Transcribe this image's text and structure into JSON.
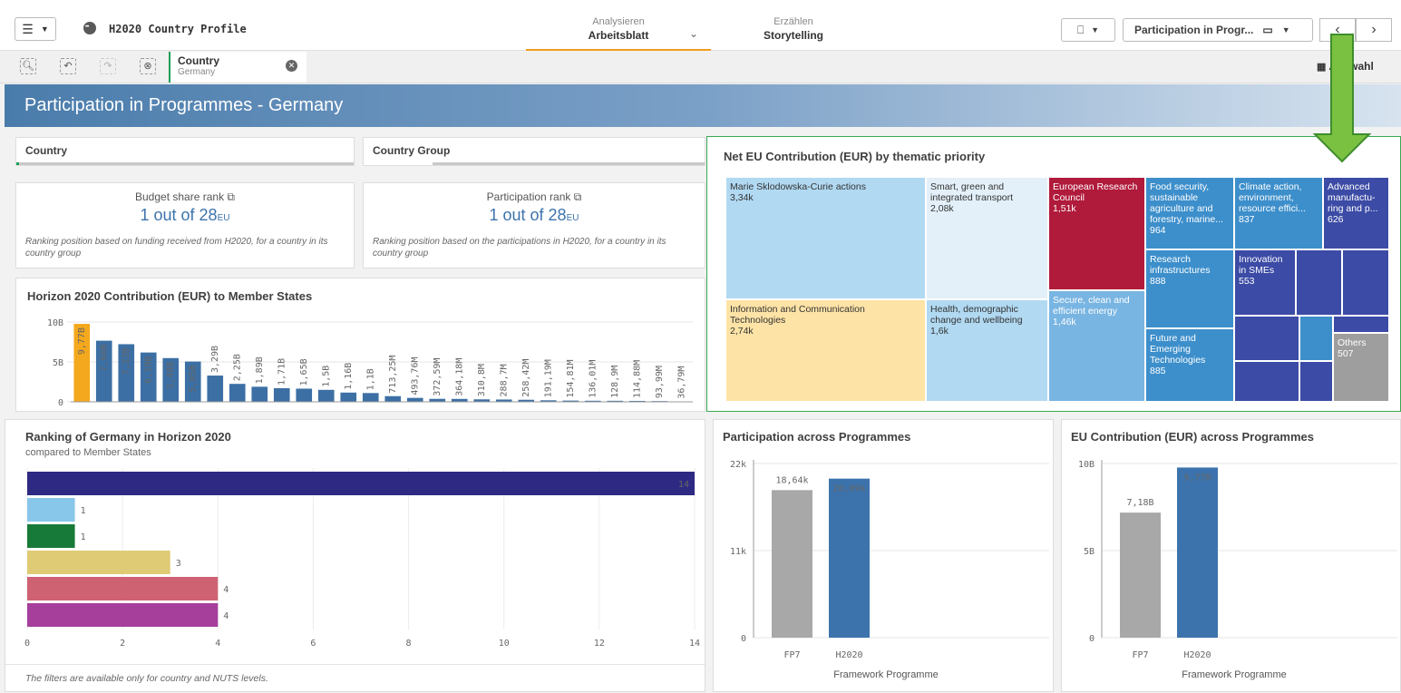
{
  "app": {
    "title": "H2020 Country Profile"
  },
  "nav": {
    "analyze": {
      "small": "Analysieren",
      "big": "Arbeitsblatt"
    },
    "story": {
      "small": "Erzählen",
      "big": "Storytelling"
    }
  },
  "sheet_selector": "Participation in Progr...",
  "selection": {
    "field": "Country",
    "value": "Germany",
    "auswahl": "Auswahl"
  },
  "banner": "Participation in Programmes - Germany",
  "filters": {
    "country": "Country",
    "country_group": "Country Group"
  },
  "kpis": [
    {
      "label": "Budget share rank",
      "value": "1 out of 28",
      "suffix": "EU",
      "note": "Ranking position based on funding received from H2020, for a country in its country group"
    },
    {
      "label": "Participation rank",
      "value": "1 out of 28",
      "suffix": "EU",
      "note": "Ranking position based on the participations in H2020, for a country in its country group"
    }
  ],
  "contribution_chart": {
    "title": "Horizon 2020 Contribution (EUR) to Member States",
    "y_ticks": [
      "10B",
      "5B",
      "0"
    ],
    "labels": [
      "9,77B",
      "7,66B",
      "7,22B",
      "6,18B",
      "5,48B",
      "5,05B",
      "3,29B",
      "2,25B",
      "1,89B",
      "1,71B",
      "1,65B",
      "1,5B",
      "1,16B",
      "1,1B",
      "713,25M",
      "493,76M",
      "372,59M",
      "364,18M",
      "310,8M",
      "288,7M",
      "258,42M",
      "191,19M",
      "154,81M",
      "136,01M",
      "128,9M",
      "114,88M",
      "93,99M",
      "36,79M"
    ]
  },
  "treemap": {
    "title": "Net EU Contribution (EUR) by thematic priority",
    "cells": [
      {
        "name": "Marie Sklodowska-Curie actions",
        "value": "3,34k"
      },
      {
        "name": "Smart, green and integrated transport",
        "value": "2,08k"
      },
      {
        "name": "European Research Council",
        "value": "1,51k"
      },
      {
        "name": "Food security, sustainable agriculture and forestry, marine...",
        "value": "964"
      },
      {
        "name": "Climate action, environment, resource effici...",
        "value": "837"
      },
      {
        "name": "Advanced manufactu-ring and p...",
        "value": "626"
      },
      {
        "name": "Research infrastructures",
        "value": "888"
      },
      {
        "name": "Innovation in SMEs",
        "value": "553"
      },
      {
        "name": "Information and Communication Technologies",
        "value": "2,74k"
      },
      {
        "name": "Health, demographic change and wellbeing",
        "value": "1,6k"
      },
      {
        "name": "Secure, clean and efficient energy",
        "value": "1,46k"
      },
      {
        "name": "Future and Emerging Technologies",
        "value": "885"
      },
      {
        "name": "Others",
        "value": "507"
      }
    ]
  },
  "ranking": {
    "title": "Ranking of Germany in Horizon 2020",
    "subtitle": "compared to Member States",
    "x_ticks": [
      "0",
      "2",
      "4",
      "6",
      "8",
      "10",
      "12",
      "14"
    ],
    "note": "The filters are available only for country and NUTS levels.",
    "colors": [
      "#2e2a83",
      "#88c6ea",
      "#187a38",
      "#dfcb75",
      "#cf6272",
      "#a63e9b"
    ]
  },
  "participation": {
    "title": "Participation across Programmes",
    "y_ticks": [
      "22k",
      "11k",
      "0"
    ],
    "bar_labels": [
      "18,64k",
      "20,09k"
    ],
    "categories": [
      "FP7",
      "H2020"
    ],
    "xlabel": "Framework Programme"
  },
  "eu_contribution": {
    "title": "EU Contribution (EUR) across Programmes",
    "y_ticks": [
      "10B",
      "5B",
      "0"
    ],
    "bar_labels": [
      "7,18B",
      "9,77B"
    ],
    "categories": [
      "FP7",
      "H2020"
    ],
    "xlabel": "Framework Programme"
  },
  "chart_data": [
    {
      "type": "bar",
      "title": "Horizon 2020 Contribution (EUR) to Member States",
      "ylim": [
        0,
        10
      ],
      "ylabel": "",
      "series": [
        {
          "values": [
            9.77,
            7.66,
            7.22,
            6.18,
            5.48,
            5.05,
            3.29,
            2.25,
            1.89,
            1.71,
            1.65,
            1.5,
            1.16,
            1.1,
            0.71325,
            0.49376,
            0.37259,
            0.36418,
            0.3108,
            0.2887,
            0.25842,
            0.19119,
            0.15481,
            0.13601,
            0.1289,
            0.11488,
            0.09399,
            0.03679
          ]
        }
      ]
    },
    {
      "type": "bar",
      "title": "Ranking of Germany in Horizon 2020",
      "xlim": [
        0,
        14
      ],
      "values": [
        14,
        1,
        1,
        3,
        4,
        4
      ]
    },
    {
      "type": "bar",
      "title": "Participation across Programmes",
      "categories": [
        "FP7",
        "H2020"
      ],
      "values": [
        18640,
        20090
      ],
      "ylim": [
        0,
        22000
      ],
      "xlabel": "Framework Programme"
    },
    {
      "type": "bar",
      "title": "EU Contribution (EUR) across Programmes",
      "categories": [
        "FP7",
        "H2020"
      ],
      "values": [
        7.18,
        9.77
      ],
      "ylim": [
        0,
        10
      ],
      "xlabel": "Framework Programme"
    }
  ]
}
